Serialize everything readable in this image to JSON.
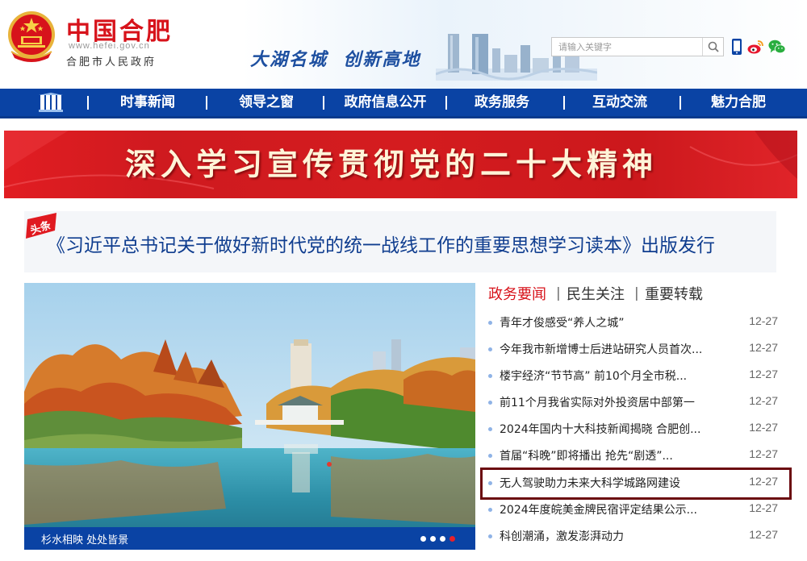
{
  "header": {
    "site_title": "中国合肥",
    "site_domain": "www.hefei.gov.cn",
    "site_subtitle": "合肥市人民政府",
    "slogan": "大湖名城  创新高地",
    "search_placeholder": "请输入关键字"
  },
  "nav": {
    "items": [
      {
        "label": "时事新闻"
      },
      {
        "label": "领导之窗"
      },
      {
        "label": "政府信息公开"
      },
      {
        "label": "政务服务"
      },
      {
        "label": "互动交流"
      },
      {
        "label": "魅力合肥"
      }
    ]
  },
  "banner": {
    "text": "深入学习宣传贯彻党的二十大精神"
  },
  "headline": {
    "badge": "头条",
    "text": "《习近平总书记关于做好新时代党的统一战线工作的重要思想学习读本》出版发行"
  },
  "photo": {
    "caption": "杉水相映 处处皆景",
    "dots_count": 4,
    "active_dot": 4
  },
  "news": {
    "tabs": [
      {
        "label": "政务要闻",
        "active": true
      },
      {
        "label": "民生关注",
        "active": false
      },
      {
        "label": "重要转载",
        "active": false
      }
    ],
    "items": [
      {
        "title": "青年才俊感受“养人之城”",
        "date": "12-27"
      },
      {
        "title": "今年我市新增博士后进站研究人员首次...",
        "date": "12-27"
      },
      {
        "title": "楼宇经济“节节高” 前10个月全市税...",
        "date": "12-27"
      },
      {
        "title": "前11个月我省实际对外投资居中部第一",
        "date": "12-27"
      },
      {
        "title": "2024年国内十大科技新闻揭晓 合肥创...",
        "date": "12-27"
      },
      {
        "title": "首届“科晚”即将播出 抢先“剧透”...",
        "date": "12-27"
      },
      {
        "title": "无人驾驶助力未来大科学城路网建设",
        "date": "12-27"
      },
      {
        "title": "2024年度皖美金牌民宿评定结果公示...",
        "date": "12-27"
      },
      {
        "title": "科创潮涌，激发澎湃动力",
        "date": "12-27"
      }
    ]
  },
  "colors": {
    "brand_red": "#d7131b",
    "nav_blue": "#0a43a4",
    "headline_blue": "#0f3d8f",
    "highlight_border": "#6b0a10"
  },
  "icons": {
    "emblem": "national-emblem-icon",
    "search": "search-icon",
    "mobile": "mobile-phone-icon",
    "weibo": "weibo-icon",
    "wechat": "wechat-icon",
    "home": "library-home-icon"
  }
}
